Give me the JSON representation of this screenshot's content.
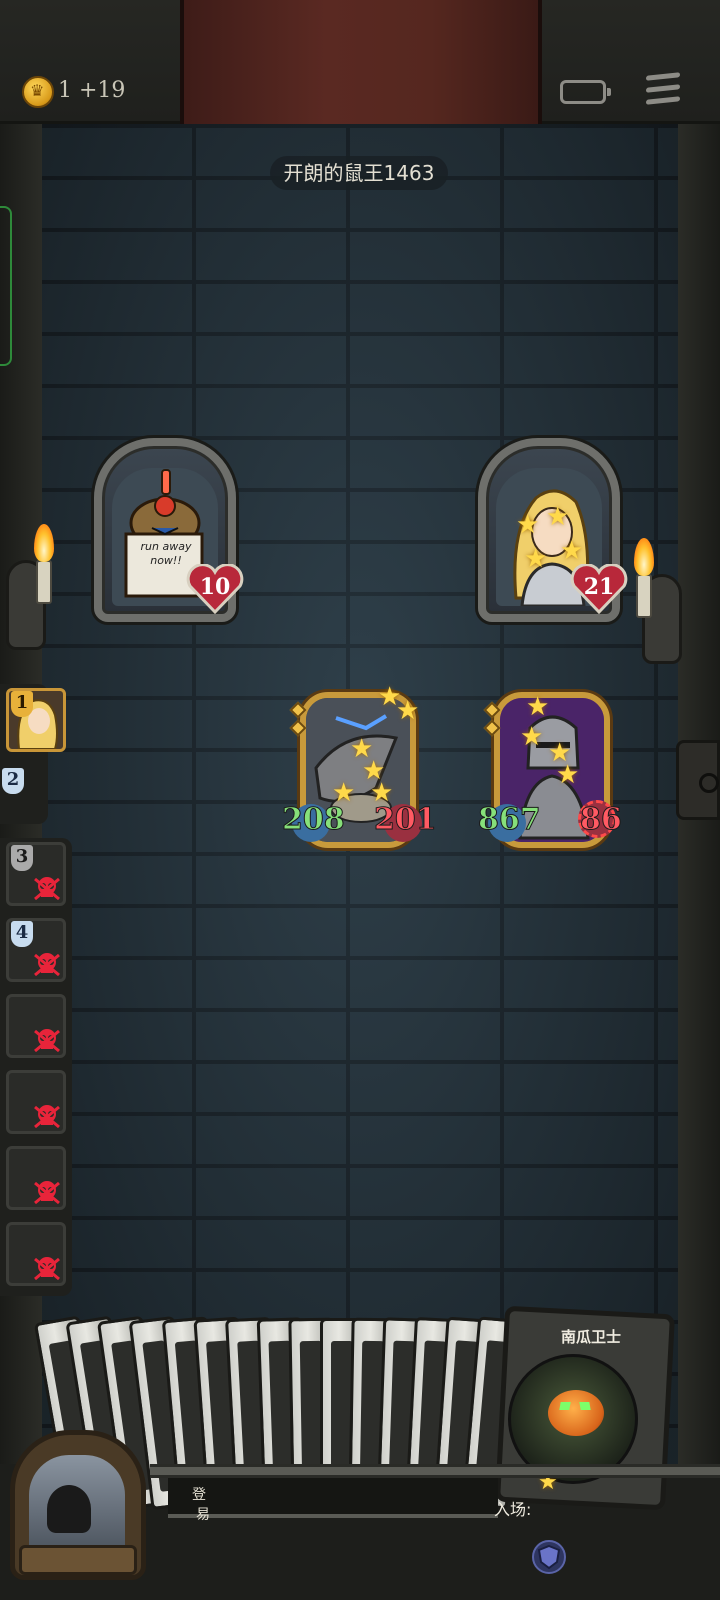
{
  "header": {
    "gold_text": "1 +19",
    "coin_icon": "crown-coin-icon",
    "battery_icon": "battery-icon",
    "menu_icon": "menu-icon"
  },
  "opponent": {
    "name": "开朗的鼠王1463"
  },
  "board": {
    "enemy_hero": {
      "health": "10",
      "sign_text": "run away now!!"
    },
    "player_hero": {
      "health": "21"
    },
    "minions": [
      {
        "attack": "208",
        "health": "201"
      },
      {
        "attack": "867",
        "health": "86"
      }
    ]
  },
  "roster": {
    "current": [
      {
        "rank": "1"
      },
      {
        "rank": "2"
      }
    ],
    "eliminated": [
      {
        "rank": "3"
      },
      {
        "rank": "4"
      },
      {
        "rank": ""
      },
      {
        "rank": ""
      },
      {
        "rank": ""
      },
      {
        "rank": ""
      }
    ]
  },
  "hand": {
    "featured_card_name": "南瓜卫士",
    "enter_label": "入场:",
    "partial_labels": [
      "登",
      "易"
    ]
  },
  "colors": {
    "attack": "#86e07a",
    "health": "#ff5a63",
    "gold_frame": "#c89a3b",
    "wall": "#27353e"
  }
}
